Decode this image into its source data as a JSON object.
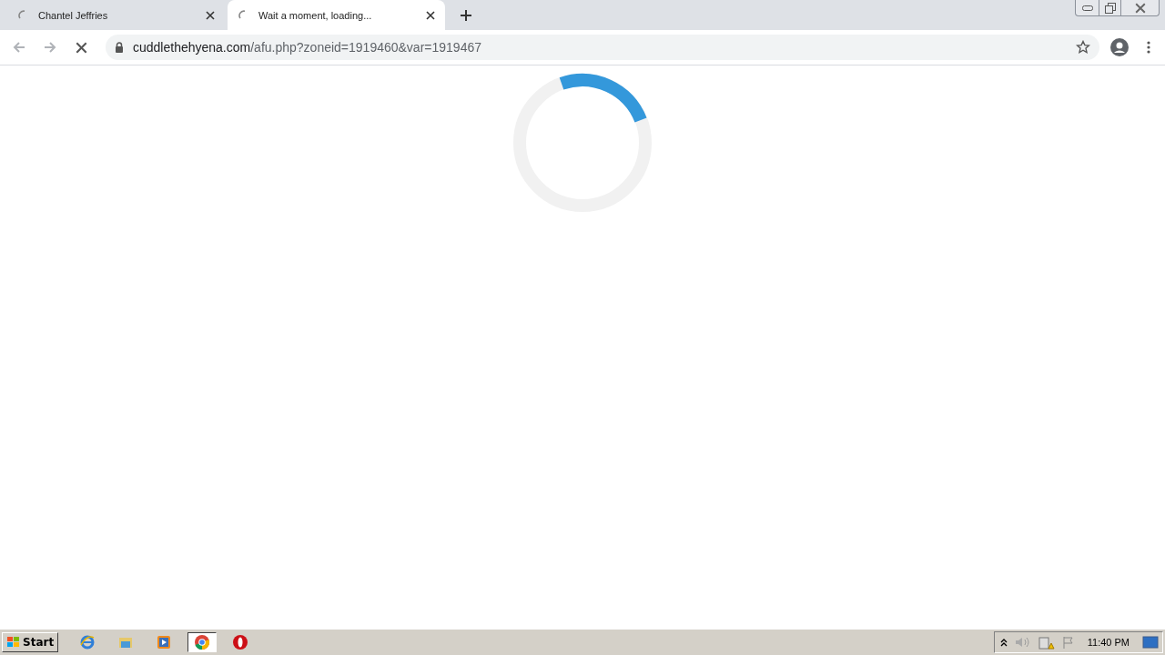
{
  "tabs": [
    {
      "title": "Chantel Jeffries",
      "loading": true,
      "selected": false
    },
    {
      "title": "Wait a moment, loading...",
      "loading": true,
      "selected": true
    }
  ],
  "address_bar": {
    "host": "cuddlethehyena.com",
    "path": "/afu.php?zoneid=1919460&var=1919467",
    "loading": true
  },
  "taskbar": {
    "start_label": "Start",
    "apps": [
      {
        "kind": "ie",
        "selected": false
      },
      {
        "kind": "explorer",
        "selected": false
      },
      {
        "kind": "media",
        "selected": false
      },
      {
        "kind": "chrome",
        "selected": true
      },
      {
        "kind": "opera",
        "selected": false
      }
    ],
    "clock": "11:40 PM"
  }
}
